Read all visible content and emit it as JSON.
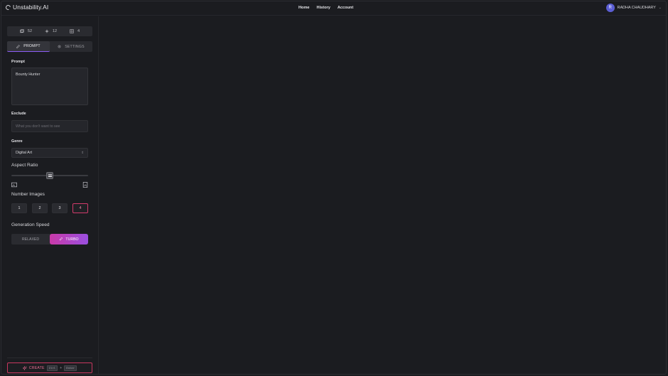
{
  "app": {
    "name": "Unstability.AI"
  },
  "nav": {
    "home": "Home",
    "history": "History",
    "account": "Account"
  },
  "user": {
    "initial": "R",
    "name": "RADHA CHAUDHARY"
  },
  "stats": {
    "images": "52",
    "boosts": "12",
    "grid": "4"
  },
  "tabs": {
    "prompt": "PROMPT",
    "settings": "SETTINGS",
    "active": "prompt"
  },
  "prompt": {
    "label": "Prompt",
    "value": "Bounty Hunter"
  },
  "exclude": {
    "label": "Exclude",
    "placeholder": "What you don't want to see"
  },
  "genre": {
    "label": "Genre",
    "value": "Digital Art"
  },
  "aspect_ratio": {
    "label": "Aspect Ratio",
    "slider_fraction": 0.5
  },
  "number_images": {
    "label": "Number Images",
    "options": [
      "1",
      "2",
      "3",
      "4"
    ],
    "selected": "4"
  },
  "generation_speed": {
    "label": "Generation Speed",
    "relaxed": "RELAXED",
    "turbo": "TURBO",
    "selected": "turbo"
  },
  "create": {
    "label": "CREATE",
    "key1": "Ctrl",
    "plus": "+",
    "key2": "Enter"
  },
  "colors": {
    "accent": "#8b5cf6",
    "create_border": "#c8375f",
    "turbo_start": "#c93aa8",
    "turbo_end": "#9a4fe0",
    "avatar": "#5b5ed4"
  }
}
